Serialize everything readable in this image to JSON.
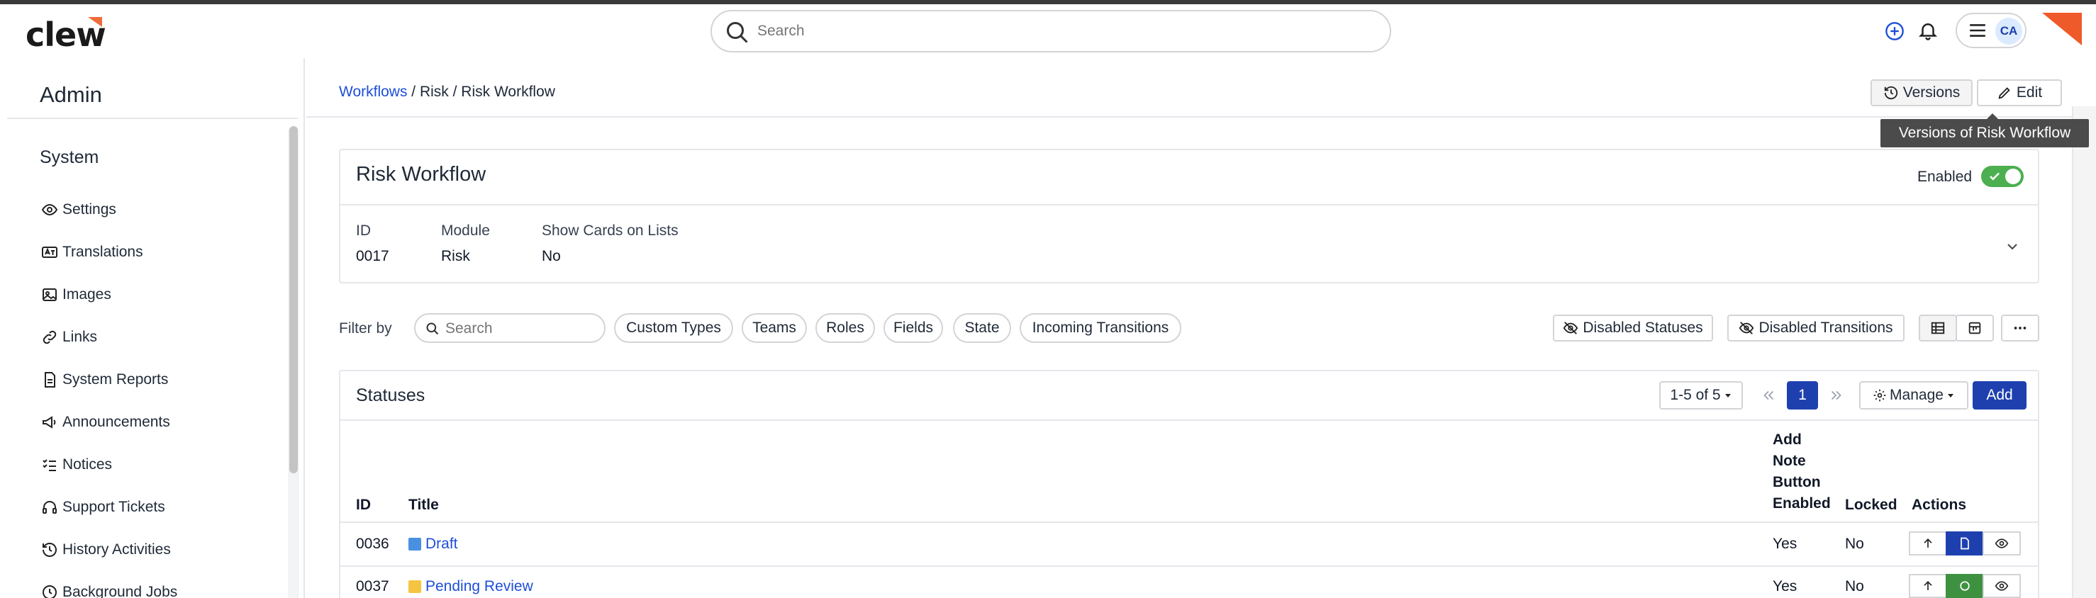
{
  "header": {
    "logo_text": "clew",
    "search_placeholder": "Search",
    "user_initials": "CA",
    "colors": {
      "logo_accent": "#ef6c3a",
      "avatar_bg": "#dbeafe"
    }
  },
  "sidebar": {
    "heading": "Admin",
    "section_title": "System",
    "items": [
      {
        "label": "Settings",
        "icon": "eye-icon"
      },
      {
        "label": "Translations",
        "icon": "translate-icon"
      },
      {
        "label": "Images",
        "icon": "image-icon"
      },
      {
        "label": "Links",
        "icon": "link-icon"
      },
      {
        "label": "System Reports",
        "icon": "report-icon"
      },
      {
        "label": "Announcements",
        "icon": "megaphone-icon"
      },
      {
        "label": "Notices",
        "icon": "list-check-icon"
      },
      {
        "label": "Support Tickets",
        "icon": "headset-icon"
      },
      {
        "label": "History Activities",
        "icon": "history-icon"
      },
      {
        "label": "Background Jobs",
        "icon": "clock-icon"
      }
    ]
  },
  "breadcrumb": {
    "link": "Workflows",
    "rest": " / Risk / Risk Workflow"
  },
  "toolbar": {
    "versions_label": "Versions",
    "edit_label": "Edit",
    "tooltip": "Versions of Risk Workflow"
  },
  "workflow": {
    "title": "Risk Workflow",
    "enabled_label": "Enabled",
    "enabled": true,
    "meta": [
      {
        "label": "ID",
        "value": "0017"
      },
      {
        "label": "Module",
        "value": "Risk"
      },
      {
        "label": "Show Cards on Lists",
        "value": "No"
      }
    ]
  },
  "filters": {
    "label": "Filter by",
    "search_placeholder": "Search",
    "chips": [
      "Custom Types",
      "Teams",
      "Roles",
      "Fields",
      "State",
      "Incoming Transitions"
    ],
    "disabled_statuses_label": "Disabled Statuses",
    "disabled_transitions_label": "Disabled Transitions"
  },
  "statuses": {
    "title": "Statuses",
    "range_label": "1-5 of 5",
    "current_page": "1",
    "manage_label": "Manage",
    "add_label": "Add",
    "columns": {
      "id": "ID",
      "title": "Title",
      "add_note_1": "Add",
      "add_note_2": "Note",
      "add_note_3": "Button",
      "add_note_4": "Enabled",
      "locked": "Locked",
      "actions": "Actions"
    },
    "rows": [
      {
        "id": "0036",
        "title": "Draft",
        "color": "#4a90e2",
        "add_note": "Yes",
        "locked": "No",
        "action_color": "#1e40af"
      },
      {
        "id": "0037",
        "title": "Pending Review",
        "color": "#f5c542",
        "add_note": "Yes",
        "locked": "No",
        "action_color": "#3f9142"
      }
    ]
  }
}
